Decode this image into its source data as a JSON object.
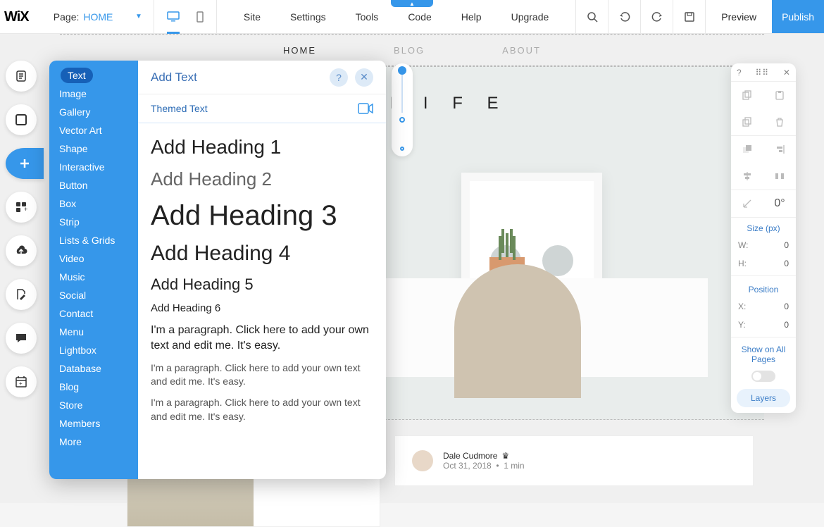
{
  "topbar": {
    "page_label": "Page:",
    "page_name": "HOME",
    "menu": [
      "Site",
      "Settings",
      "Tools",
      "Code",
      "Help",
      "Upgrade"
    ],
    "preview": "Preview",
    "publish": "Publish"
  },
  "left_rail": [
    {
      "name": "pages-icon"
    },
    {
      "name": "background-icon"
    },
    {
      "name": "add-icon",
      "active": true
    },
    {
      "name": "apps-icon"
    },
    {
      "name": "uploads-icon"
    },
    {
      "name": "blog-manager-icon"
    },
    {
      "name": "chat-icon"
    },
    {
      "name": "bookings-icon"
    }
  ],
  "add_panel": {
    "title": "Add Text",
    "categories": [
      "Text",
      "Image",
      "Gallery",
      "Vector Art",
      "Shape",
      "Interactive",
      "Button",
      "Box",
      "Strip",
      "Lists & Grids",
      "Video",
      "Music",
      "Social",
      "Contact",
      "Menu",
      "Lightbox",
      "Database",
      "Blog",
      "Store",
      "Members",
      "More"
    ],
    "active_category": "Text",
    "themed_label": "Themed Text",
    "samples": {
      "h1": "Add Heading 1",
      "h2": "Add Heading 2",
      "h3": "Add Heading 3",
      "h4": "Add Heading 4",
      "h5": "Add Heading 5",
      "h6": "Add Heading 6",
      "p1": "I'm a paragraph. Click here to add your own text and edit me. It's easy.",
      "p2": "I'm a paragraph. Click here to add your own text and edit me. It's easy.",
      "p3": "I'm a paragraph. Click here to add your own text and edit me. It's easy."
    }
  },
  "page": {
    "nav": [
      "HOME",
      "BLOG",
      "ABOUT"
    ],
    "hero_title_right": "O R   L I F E",
    "article": {
      "author": "Dale Cudmore",
      "date": "Oct 31, 2018",
      "read": "1 min"
    }
  },
  "props": {
    "rotation": "0°",
    "size_label": "Size (px)",
    "w_label": "W:",
    "w_val": "0",
    "h_label": "H:",
    "h_val": "0",
    "pos_label": "Position",
    "x_label": "X:",
    "x_val": "0",
    "y_label": "Y:",
    "y_val": "0",
    "show_all": "Show on All Pages",
    "layers": "Layers",
    "help": "?"
  }
}
